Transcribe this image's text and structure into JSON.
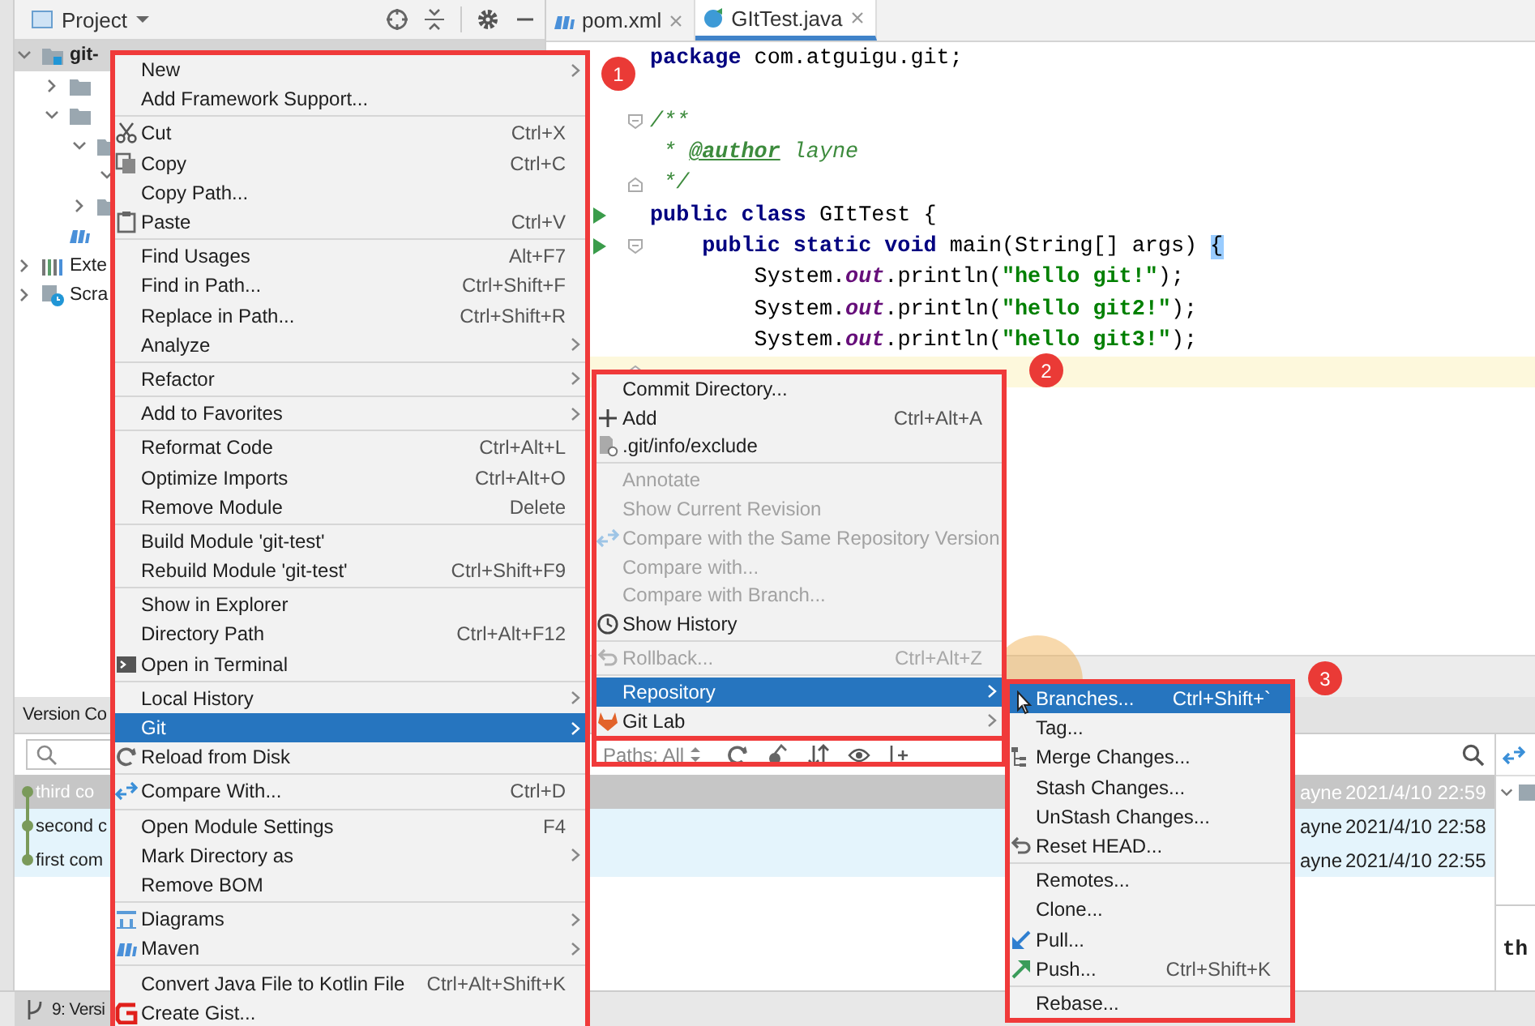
{
  "project_panel": {
    "title": "Project",
    "tree": [
      {
        "label": "git-",
        "kind": "module",
        "expanded": true,
        "selected": true,
        "children": [
          {
            "kind": "folder",
            "expanded": false,
            "selected": false
          },
          {
            "kind": "folder",
            "expanded": true,
            "selected": false,
            "children": [
              {
                "kind": "folder",
                "expanded": true,
                "selected": false,
                "children": [
                  {
                    "expanded": true,
                    "selected": false
                  }
                ]
              },
              {
                "kind": "folder",
                "expanded": false,
                "selected": false
              }
            ]
          },
          {
            "kind": "maven",
            "selected": false
          }
        ]
      },
      {
        "label": "Exte",
        "kind": "libraries",
        "expanded": false,
        "selected": false
      },
      {
        "label": "Scra",
        "kind": "scratches",
        "expanded": false,
        "selected": false
      }
    ]
  },
  "editor": {
    "tabs": [
      {
        "label": "pom.xml",
        "kind": "maven",
        "selected": false
      },
      {
        "label": "GItTest.java",
        "kind": "java",
        "selected": true
      }
    ],
    "lines": [
      {
        "tokens": [
          {
            "text": "package",
            "kind": "keyword"
          },
          {
            "text": " com.atguigu.git;",
            "kind": "plain"
          }
        ],
        "run": false,
        "fold_start": false,
        "fold_end": false,
        "current": false
      },
      {
        "run": false,
        "fold_start": false,
        "fold_end": false,
        "current": false
      },
      {
        "tokens": [
          {
            "text": "/**",
            "kind": "doc"
          }
        ],
        "run": false,
        "fold_start": true,
        "fold_end": false,
        "current": false
      },
      {
        "tokens": [
          {
            "text": " * ",
            "kind": "doc"
          },
          {
            "text": "@author",
            "kind": "doc-tag"
          },
          {
            "text": " layne",
            "kind": "doc-italic"
          }
        ],
        "run": false,
        "fold_start": false,
        "fold_end": false,
        "current": false
      },
      {
        "tokens": [
          {
            "text": " */",
            "kind": "doc"
          }
        ],
        "run": false,
        "fold_start": false,
        "fold_end": true,
        "current": false
      },
      {
        "tokens": [
          {
            "text": "public class",
            "kind": "keyword"
          },
          {
            "text": " GItTest {",
            "kind": "plain"
          }
        ],
        "run": true,
        "fold_start": false,
        "fold_end": false,
        "current": false
      },
      {
        "tokens": [
          {
            "text": "    public static void",
            "kind": "keyword"
          },
          {
            "text": " main(String[] args) ",
            "kind": "plain"
          },
          {
            "text": "{",
            "kind": "brace"
          }
        ],
        "run": true,
        "fold_start": true,
        "fold_end": false,
        "current": false
      },
      {
        "tokens": [
          {
            "text": "        System.",
            "kind": "plain"
          },
          {
            "text": "out",
            "kind": "field"
          },
          {
            "text": ".println(",
            "kind": "plain"
          },
          {
            "text": "\"hello git!\"",
            "kind": "string"
          },
          {
            "text": ");",
            "kind": "plain"
          }
        ],
        "run": false,
        "fold_start": false,
        "fold_end": false,
        "current": false
      },
      {
        "tokens": [
          {
            "text": "        System.",
            "kind": "plain"
          },
          {
            "text": "out",
            "kind": "field"
          },
          {
            "text": ".println(",
            "kind": "plain"
          },
          {
            "text": "\"hello git2!\"",
            "kind": "string"
          },
          {
            "text": ");",
            "kind": "plain"
          }
        ],
        "run": false,
        "fold_start": false,
        "fold_end": false,
        "current": false
      },
      {
        "tokens": [
          {
            "text": "        System.",
            "kind": "plain"
          },
          {
            "text": "out",
            "kind": "field"
          },
          {
            "text": ".println(",
            "kind": "plain"
          },
          {
            "text": "\"hello git3!\"",
            "kind": "string"
          },
          {
            "text": ");",
            "kind": "plain"
          }
        ],
        "run": false,
        "fold_start": false,
        "fold_end": false,
        "current": false
      },
      {
        "run": false,
        "fold_start": false,
        "fold_end": true,
        "current": true
      }
    ]
  },
  "version_control": {
    "title": "Version Co",
    "paths_label": "Paths: All",
    "commits": [
      {
        "subject": "third co",
        "author": "ayne",
        "date": "2021/4/10 22:59",
        "selected": true
      },
      {
        "subject": "second c",
        "author": "ayne",
        "date": "2021/4/10 22:58",
        "selected": false
      },
      {
        "subject": "first com",
        "author": "ayne",
        "date": "2021/4/10 22:55",
        "selected": false
      }
    ],
    "details_text": "th"
  },
  "status_bar": {
    "tab": "9: Versi"
  },
  "menus": [
    {
      "items": [
        {
          "kind": "item",
          "label": "New",
          "submenu": true,
          "selected": false
        },
        {
          "kind": "item",
          "label": "Add Framework Support...",
          "selected": false
        },
        {
          "kind": "separator"
        },
        {
          "kind": "item",
          "label": "Cut",
          "shortcut": "Ctrl+X",
          "selected": false
        },
        {
          "kind": "item",
          "label": "Copy",
          "shortcut": "Ctrl+C",
          "selected": false
        },
        {
          "kind": "item",
          "label": "Copy Path...",
          "selected": false
        },
        {
          "kind": "item",
          "label": "Paste",
          "shortcut": "Ctrl+V",
          "selected": false
        },
        {
          "kind": "separator"
        },
        {
          "kind": "item",
          "label": "Find Usages",
          "shortcut": "Alt+F7",
          "selected": false
        },
        {
          "kind": "item",
          "label": "Find in Path...",
          "shortcut": "Ctrl+Shift+F",
          "selected": false
        },
        {
          "kind": "item",
          "label": "Replace in Path...",
          "shortcut": "Ctrl+Shift+R",
          "selected": false
        },
        {
          "kind": "item",
          "label": "Analyze",
          "submenu": true,
          "selected": false
        },
        {
          "kind": "separator"
        },
        {
          "kind": "item",
          "label": "Refactor",
          "submenu": true,
          "selected": false
        },
        {
          "kind": "separator"
        },
        {
          "kind": "item",
          "label": "Add to Favorites",
          "submenu": true,
          "selected": false
        },
        {
          "kind": "separator"
        },
        {
          "kind": "item",
          "label": "Reformat Code",
          "shortcut": "Ctrl+Alt+L",
          "selected": false
        },
        {
          "kind": "item",
          "label": "Optimize Imports",
          "shortcut": "Ctrl+Alt+O",
          "selected": false
        },
        {
          "kind": "item",
          "label": "Remove Module",
          "shortcut": "Delete",
          "selected": false
        },
        {
          "kind": "separator"
        },
        {
          "kind": "item",
          "label": "Build Module 'git-test'",
          "selected": false
        },
        {
          "kind": "item",
          "label": "Rebuild Module 'git-test'",
          "shortcut": "Ctrl+Shift+F9",
          "selected": false
        },
        {
          "kind": "separator"
        },
        {
          "kind": "item",
          "label": "Show in Explorer",
          "selected": false
        },
        {
          "kind": "item",
          "label": "Directory Path",
          "shortcut": "Ctrl+Alt+F12",
          "selected": false
        },
        {
          "kind": "item",
          "label": "Open in Terminal",
          "selected": false
        },
        {
          "kind": "separator"
        },
        {
          "kind": "item",
          "label": "Local History",
          "submenu": true,
          "selected": false
        },
        {
          "kind": "item",
          "label": "Git",
          "submenu": true,
          "selected": true
        },
        {
          "kind": "item",
          "label": "Reload from Disk",
          "selected": false
        },
        {
          "kind": "separator"
        },
        {
          "kind": "item",
          "label": "Compare With...",
          "shortcut": "Ctrl+D",
          "selected": false
        },
        {
          "kind": "separator"
        },
        {
          "kind": "item",
          "label": "Open Module Settings",
          "shortcut": "F4",
          "selected": false
        },
        {
          "kind": "item",
          "label": "Mark Directory as",
          "submenu": true,
          "selected": false
        },
        {
          "kind": "item",
          "label": "Remove BOM",
          "selected": false
        },
        {
          "kind": "separator"
        },
        {
          "kind": "item",
          "label": "Diagrams",
          "submenu": true,
          "selected": false
        },
        {
          "kind": "item",
          "label": "Maven",
          "submenu": true,
          "selected": false
        },
        {
          "kind": "separator"
        },
        {
          "kind": "item",
          "label": "Convert Java File to Kotlin File",
          "shortcut": "Ctrl+Alt+Shift+K",
          "selected": false
        },
        {
          "kind": "item",
          "label": "Create Gist...",
          "selected": false
        }
      ]
    },
    {
      "items": [
        {
          "kind": "item",
          "label": "Commit Directory...",
          "selected": false,
          "disabled": false
        },
        {
          "kind": "item",
          "label": "Add",
          "shortcut": "Ctrl+Alt+A",
          "selected": false,
          "disabled": false
        },
        {
          "kind": "item",
          "label": ".git/info/exclude",
          "selected": false,
          "disabled": false
        },
        {
          "kind": "separator"
        },
        {
          "kind": "item",
          "label": "Annotate",
          "selected": false,
          "disabled": true
        },
        {
          "kind": "item",
          "label": "Show Current Revision",
          "selected": false,
          "disabled": true
        },
        {
          "kind": "item",
          "label": "Compare with the Same Repository Version",
          "selected": false,
          "disabled": true
        },
        {
          "kind": "item",
          "label": "Compare with...",
          "selected": false,
          "disabled": true
        },
        {
          "kind": "item",
          "label": "Compare with Branch...",
          "selected": false,
          "disabled": true
        },
        {
          "kind": "item",
          "label": "Show History",
          "selected": false,
          "disabled": false
        },
        {
          "kind": "separator"
        },
        {
          "kind": "item",
          "label": "Rollback...",
          "shortcut": "Ctrl+Alt+Z",
          "selected": false,
          "disabled": true
        },
        {
          "kind": "separator"
        },
        {
          "kind": "item",
          "label": "Repository",
          "submenu": true,
          "selected": true,
          "disabled": false
        },
        {
          "kind": "item",
          "label": "Git Lab",
          "submenu": true,
          "selected": false,
          "disabled": false
        }
      ]
    },
    {
      "items": [
        {
          "kind": "item",
          "label": "Branches...",
          "shortcut": "Ctrl+Shift+`",
          "selected": true
        },
        {
          "kind": "item",
          "label": "Tag...",
          "selected": false
        },
        {
          "kind": "item",
          "label": "Merge Changes...",
          "selected": false
        },
        {
          "kind": "item",
          "label": "Stash Changes...",
          "selected": false
        },
        {
          "kind": "item",
          "label": "UnStash Changes...",
          "selected": false
        },
        {
          "kind": "item",
          "label": "Reset HEAD...",
          "selected": false
        },
        {
          "kind": "separator"
        },
        {
          "kind": "item",
          "label": "Remotes...",
          "selected": false
        },
        {
          "kind": "item",
          "label": "Clone...",
          "selected": false
        },
        {
          "kind": "item",
          "label": "Pull...",
          "selected": false
        },
        {
          "kind": "item",
          "label": "Push...",
          "shortcut": "Ctrl+Shift+K",
          "selected": false
        },
        {
          "kind": "separator"
        },
        {
          "kind": "item",
          "label": "Rebase...",
          "selected": false
        }
      ]
    }
  ],
  "annotations": [
    {
      "number": "1"
    },
    {
      "number": "2"
    },
    {
      "number": "3"
    }
  ]
}
